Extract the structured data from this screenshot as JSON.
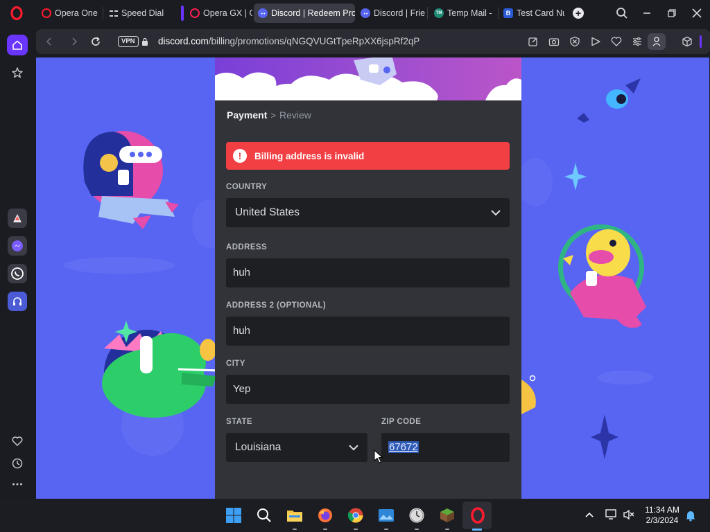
{
  "tabs": [
    {
      "label": "Opera One",
      "icon": "opera-icon",
      "active": false
    },
    {
      "label": "Speed Dial",
      "icon": "speed-dial-icon",
      "active": false
    },
    {
      "label": "Opera GX | G",
      "icon": "opera-gx-icon",
      "active": false
    },
    {
      "label": "Discord | Redeem Pro",
      "icon": "discord-icon",
      "active": true
    },
    {
      "label": "Discord | Frie",
      "icon": "discord-icon",
      "active": false
    },
    {
      "label": "Temp Mail -",
      "icon": "temp-mail-icon",
      "active": false
    },
    {
      "label": "Test Card Nu",
      "icon": "test-card-icon",
      "active": false
    }
  ],
  "temp_mail_badge": "TM",
  "test_card_badge": "B",
  "address_bar": {
    "vpn_label": "VPN",
    "url_domain": "discord.com",
    "url_path": "/billing/promotions/qNGQVUGtTpeRpXX6jspRf2qP"
  },
  "breadcrumb": {
    "current": "Payment",
    "separator": ">",
    "next": "Review"
  },
  "error": {
    "icon": "!",
    "message": "Billing address is invalid"
  },
  "form": {
    "country": {
      "label": "COUNTRY",
      "value": "United States"
    },
    "address": {
      "label": "ADDRESS",
      "value": "huh"
    },
    "address2": {
      "label": "ADDRESS 2 (OPTIONAL)",
      "value": "huh"
    },
    "city": {
      "label": "CITY",
      "value": "Yep"
    },
    "state": {
      "label": "STATE",
      "value": "Louisiana"
    },
    "zip": {
      "label": "ZIP CODE",
      "value": "67672"
    }
  },
  "taskbar": {
    "time": "11:34 AM",
    "date": "2/3/2024",
    "apps": [
      "windows-start-icon",
      "search-icon",
      "file-explorer-icon",
      "firefox-icon",
      "chrome-icon",
      "photos-icon",
      "clock-app-icon",
      "minecraft-icon",
      "opera-icon"
    ]
  },
  "colors": {
    "discord_blurple": "#5865f2",
    "error_red": "#f23f43",
    "modal_bg": "#313338",
    "input_bg": "#1e1f22",
    "opera_red": "#ff1b2d",
    "opera_accent": "#6a35ff"
  }
}
